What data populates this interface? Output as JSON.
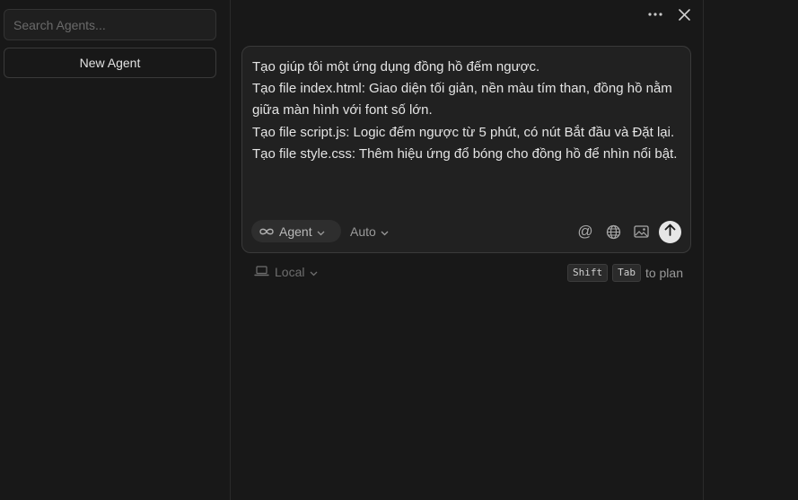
{
  "sidebar": {
    "search_placeholder": "Search Agents...",
    "new_agent_label": "New Agent"
  },
  "header": {
    "more_icon": "ellipsis-icon",
    "close_icon": "close-icon"
  },
  "composer": {
    "prompt_text": "Tạo giúp tôi một ứng dụng đồng hồ đếm ngược.\nTạo file index.html: Giao diện tối giản, nền màu tím than, đồng hồ nằm giữa màn hình với font số lớn.\nTạo file script.js: Logic đếm ngược từ 5 phút, có nút Bắt đầu và Đặt lại.\nTạo file style.css: Thêm hiệu ứng đổ bóng cho đồng hồ để nhìn nổi bật.",
    "mode_label": "Agent",
    "model_label": "Auto",
    "mention_symbol": "@"
  },
  "footer": {
    "environment_label": "Local",
    "shortcut_keys": [
      "Shift",
      "Tab"
    ],
    "shortcut_suffix": "to plan"
  },
  "colors": {
    "background": "#181818",
    "composer_bg": "#212121",
    "border": "#3a3a3a",
    "send_button": "#e6e6e6"
  }
}
